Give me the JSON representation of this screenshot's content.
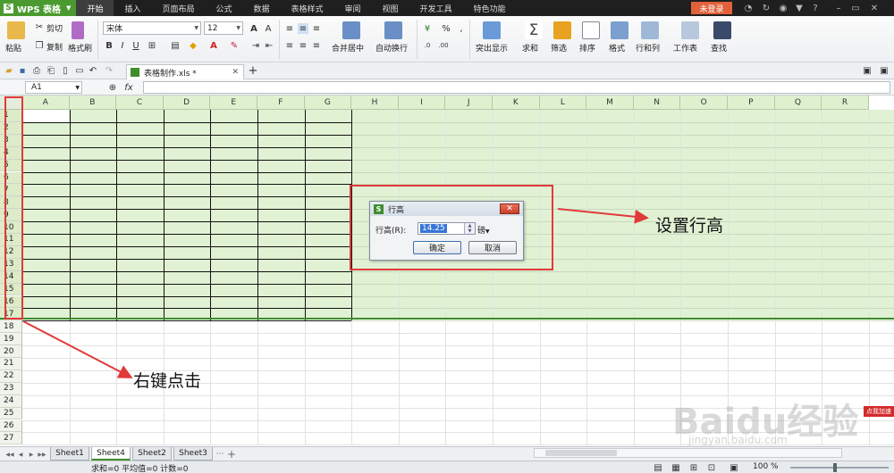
{
  "app": {
    "title": "WPS 表格",
    "logo_letter": "S"
  },
  "menu": {
    "tabs": [
      "开始",
      "插入",
      "页面布局",
      "公式",
      "数据",
      "表格样式",
      "审阅",
      "视图",
      "开发工具",
      "特色功能"
    ],
    "login": "未登录"
  },
  "ribbon": {
    "paste": "粘贴",
    "cut": "剪切",
    "copy": "复制",
    "format_painter": "格式刷",
    "font_name": "宋体",
    "font_size": "12",
    "bold": "B",
    "italic": "I",
    "underline": "U",
    "merge_center": "合并居中",
    "wrap_text": "自动换行",
    "percent": "%",
    "highlight": "突出显示",
    "sum": "求和",
    "filter": "筛选",
    "sort": "排序",
    "format": "格式",
    "row_col": "行和列",
    "worksheet": "工作表",
    "find": "查找"
  },
  "doc": {
    "tab_name": "表格制作.xls *"
  },
  "formula": {
    "cell_ref": "A1",
    "fx": "fx"
  },
  "grid": {
    "columns": [
      "A",
      "B",
      "C",
      "D",
      "E",
      "F",
      "G",
      "H",
      "I",
      "J",
      "K",
      "L",
      "M",
      "N",
      "O",
      "P",
      "Q",
      "R"
    ],
    "rows": [
      "1",
      "2",
      "3",
      "4",
      "5",
      "6",
      "7",
      "8",
      "9",
      "10",
      "11",
      "12",
      "13",
      "14",
      "15",
      "16",
      "17",
      "18",
      "19",
      "20",
      "21",
      "22",
      "23",
      "24",
      "25",
      "26",
      "27"
    ]
  },
  "dialog": {
    "title": "行高",
    "label": "行高(R):",
    "value": "14.25",
    "unit": "磅",
    "ok": "确定",
    "cancel": "取消"
  },
  "annotations": {
    "set_row_height": "设置行高",
    "right_click": "右键点击"
  },
  "sheets": {
    "tabs": [
      "Sheet1",
      "Sheet4",
      "Sheet2",
      "Sheet3"
    ],
    "active": "Sheet4",
    "more": "···",
    "add": "+"
  },
  "status": {
    "text": "求和=0  平均值=0  计数=0",
    "zoom": "100 %"
  },
  "watermark": {
    "main": "Baidu经验",
    "sub": "jingyan.baidu.com",
    "badge": "点我加速"
  },
  "colors": {
    "accent_green": "#4a9a2f",
    "selection": "#e0f2d3",
    "annotation_red": "#e03a3a",
    "login_orange": "#e0613a"
  }
}
